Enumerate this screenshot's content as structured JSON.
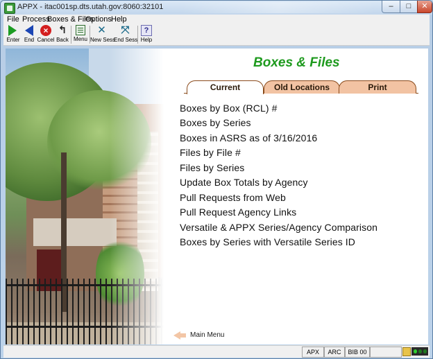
{
  "window": {
    "title": "APPX - itac001sp.dts.utah.gov:8060:32101",
    "controls": {
      "minimize": "–",
      "maximize": "□",
      "close": "✕"
    }
  },
  "menubar": {
    "items": [
      "File",
      "Process",
      "Boxes & Files",
      "Options",
      "Help"
    ]
  },
  "toolbar": {
    "buttons": [
      {
        "label": "Enter",
        "icon": "enter-arrow-icon"
      },
      {
        "label": "End",
        "icon": "end-arrow-icon"
      },
      {
        "label": "Cancel",
        "icon": "cancel-icon"
      },
      {
        "label": "Back",
        "icon": "back-icon"
      },
      {
        "label": "Menu",
        "icon": "menu-icon"
      },
      {
        "label": "New Sess",
        "icon": "new-session-icon"
      },
      {
        "label": "End Sess",
        "icon": "end-session-icon"
      },
      {
        "label": "Help",
        "icon": "help-icon"
      }
    ]
  },
  "page": {
    "title": "Boxes & Files",
    "tabs": [
      {
        "label": "Current",
        "active": true
      },
      {
        "label": "Old Locations",
        "active": false
      },
      {
        "label": "Print",
        "active": false
      }
    ],
    "links": [
      "Boxes by Box (RCL) #",
      "Boxes by Series",
      "Boxes in ASRS as of 3/16/2016",
      "Files by File #",
      "Files by Series",
      "Update Box Totals by Agency",
      "Pull Requests from Web",
      "Pull Request Agency Links",
      "Versatile & APPX Series/Agency Comparison",
      "Boxes by Series with Versatile Series ID"
    ],
    "main_menu_label": "Main Menu"
  },
  "statusbar": {
    "cells": [
      "APX",
      "ARC",
      "BIB 00"
    ]
  },
  "colors": {
    "title_green": "#1e9a1e",
    "tab_fill": "#f2c3a3",
    "tab_border": "#8a4b1c"
  }
}
